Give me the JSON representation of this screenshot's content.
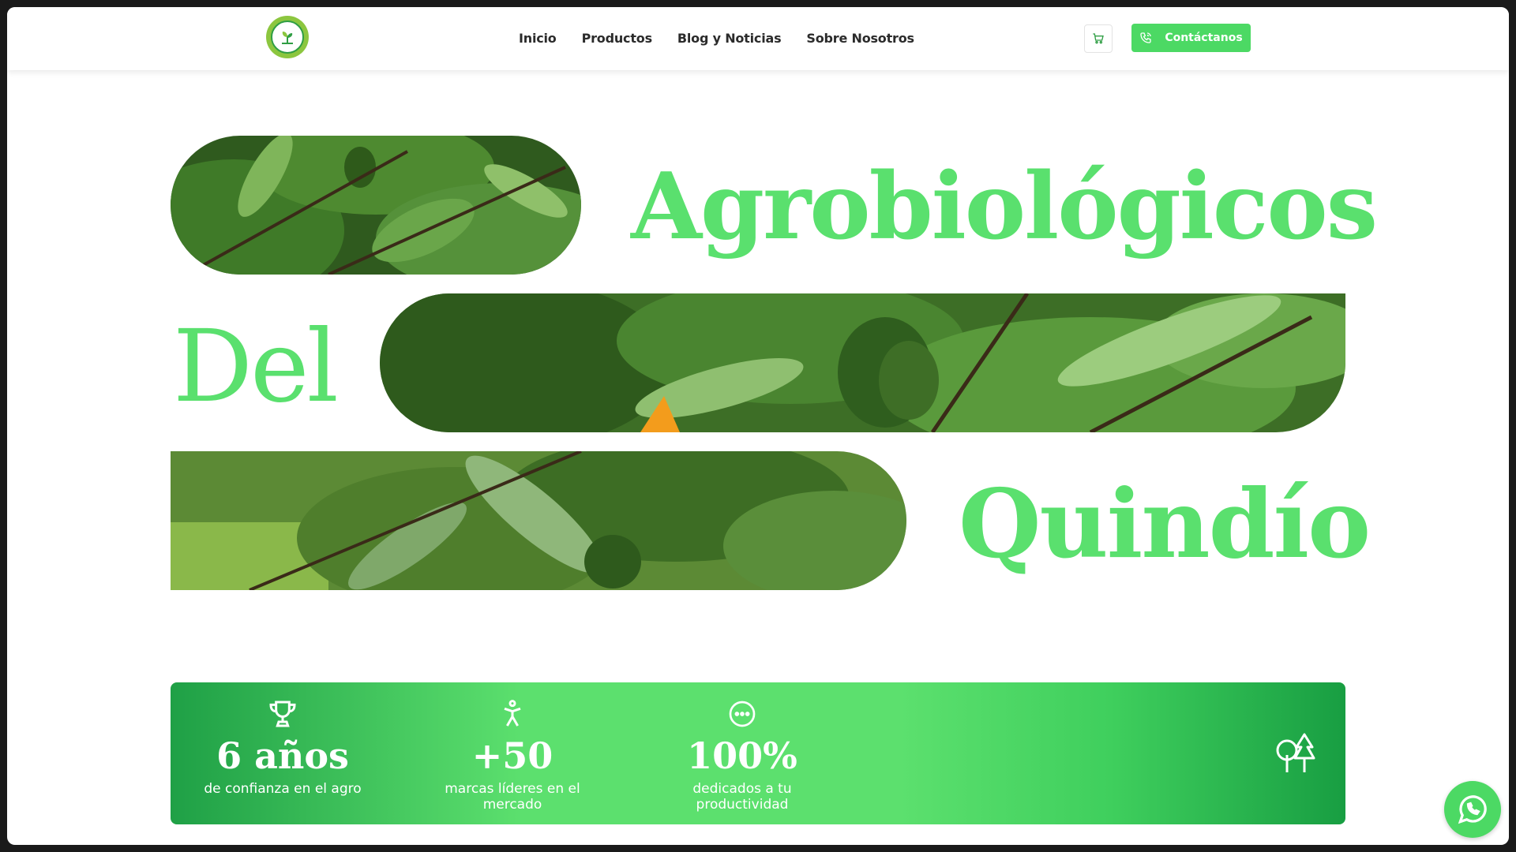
{
  "header": {
    "logo_icon": "sprout-logo",
    "nav": [
      {
        "label": "Inicio"
      },
      {
        "label": "Productos"
      },
      {
        "label": "Blog y Noticias"
      },
      {
        "label": "Sobre Nosotros"
      }
    ],
    "cart_icon": "cart-icon",
    "contact_label": "Contáctanos",
    "accent_color": "#4cd964"
  },
  "hero": {
    "line1": "Agrobiológicos",
    "line2": "Del",
    "line3": "Quindío",
    "text_color": "#5ae06e"
  },
  "stats": {
    "items": [
      {
        "icon": "trophy-icon",
        "value": "6 años",
        "label": "de confianza en el agro"
      },
      {
        "icon": "person-icon",
        "value": "+50",
        "label": "marcas líderes en el mercado"
      },
      {
        "icon": "dots-circle-icon",
        "value": "100%",
        "label": "dedicados a tu productividad"
      }
    ],
    "decor_icon": "trees-icon"
  },
  "floating": {
    "whatsapp_icon": "whatsapp-icon"
  }
}
